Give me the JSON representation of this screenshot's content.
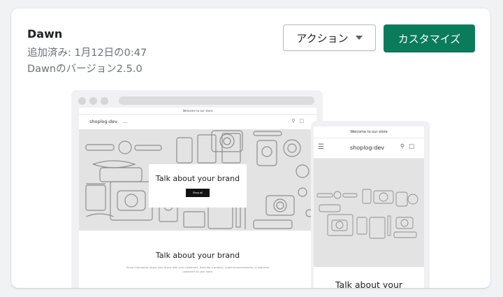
{
  "theme": {
    "name": "Dawn",
    "added_label": "追加済み: 1月12日の0:47",
    "version_label": "Dawnのバージョン2.5.0"
  },
  "buttons": {
    "actions_label": "アクション",
    "customize_label": "カスタマイズ"
  },
  "preview": {
    "announcement": "Welcome to our store",
    "store_name": "shoplog-dev",
    "nav_placeholder": "___",
    "hero_title": "Talk about your brand",
    "hero_button": "Shop all",
    "section_title": "Talk about your brand",
    "section_text": "Share information about your brand with your customers. Describe a product, make announcements, or welcome customers to your store.",
    "mobile_section_title": "Talk about your"
  },
  "colors": {
    "primary": "#0a7c5c",
    "card_bg": "#ffffff",
    "page_bg": "#f1f2f3"
  },
  "icons": [
    "caret-down-icon",
    "search-icon",
    "cart-icon",
    "menu-icon"
  ]
}
